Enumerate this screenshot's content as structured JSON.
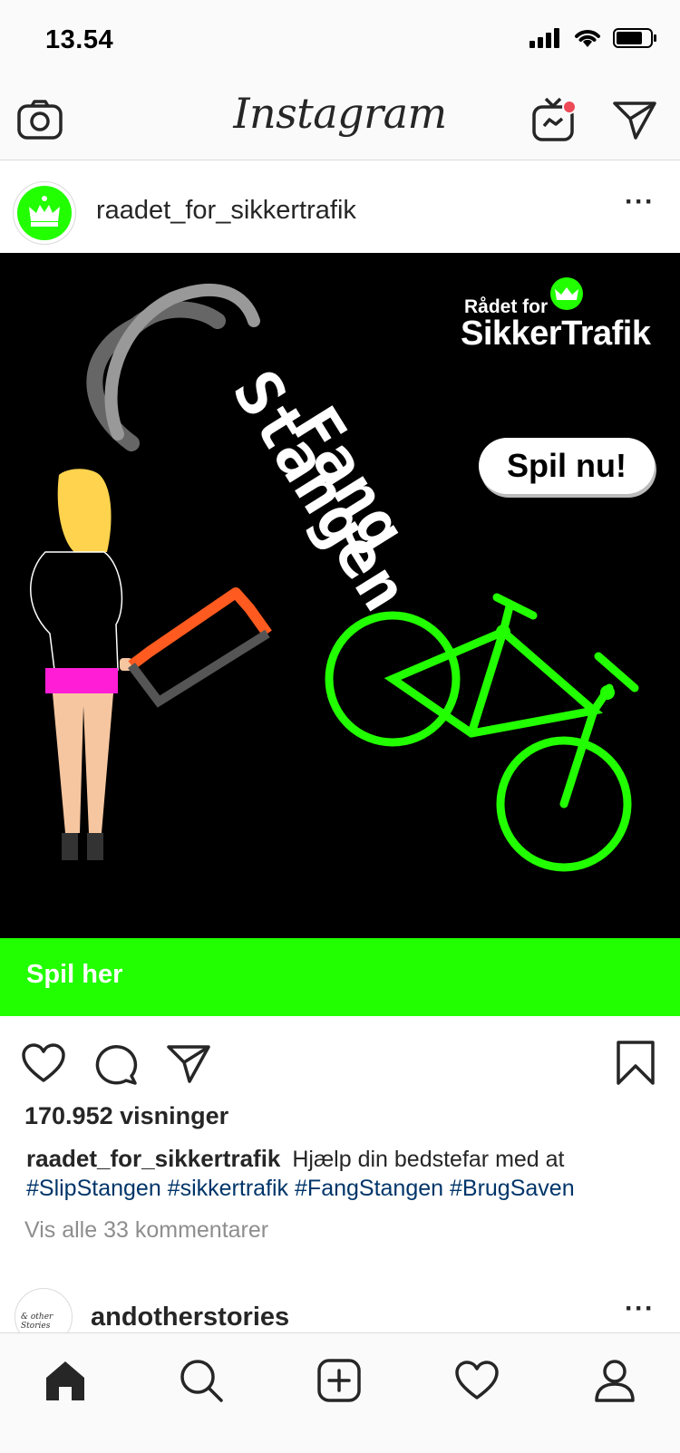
{
  "status_bar": {
    "time": "13.54",
    "icons": [
      "signal-icon",
      "wifi-icon",
      "battery-icon"
    ]
  },
  "header": {
    "logo_text": "Instagram",
    "icons": [
      "camera-icon",
      "igtv-icon",
      "direct-message-icon"
    ]
  },
  "post": {
    "username": "raadet_for_sikkertrafik",
    "more_label": "···",
    "image": {
      "brand_small": "Rådet for",
      "brand_big": "SikkerTrafik",
      "title_line1": "Fang",
      "title_line2": "Stangen",
      "button_label": "Spil nu!"
    },
    "cta_label": "Spil her",
    "views": "170.952 visninger",
    "caption_user": "raadet_for_sikkertrafik",
    "caption_text": "Hjælp din bedstefar med at",
    "hashtags": [
      "#SlipStangen",
      "#sikkertrafik",
      "#FangStangen",
      "#BrugSaven"
    ],
    "comments_link": "Vis alle 33 kommentarer"
  },
  "next_post": {
    "avatar_text": "& other Stories",
    "username": "andotherstories",
    "more_label": "···"
  },
  "colors": {
    "accent_green": "#22ff00",
    "hashtag_blue": "#003569",
    "notification_red": "#ed4956"
  }
}
